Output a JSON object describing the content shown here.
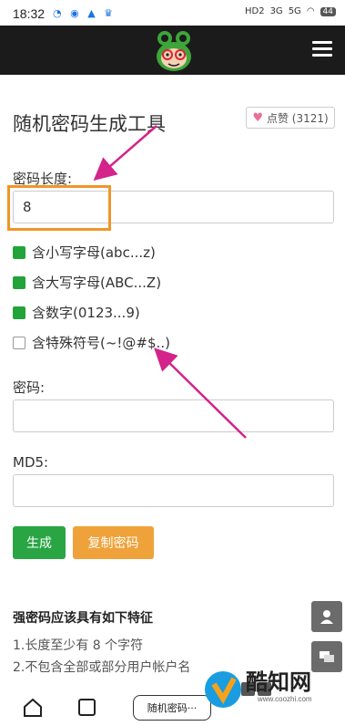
{
  "status_bar": {
    "time": "18:32",
    "battery": "44",
    "signal_texts": [
      "HD2",
      "3G",
      "5G"
    ]
  },
  "header": {
    "menu_icon": "hamburger-icon",
    "logo_icon": "frog-logo-icon"
  },
  "page": {
    "title": "随机密码生成工具",
    "like_button": {
      "label": "点赞 (3121)",
      "icon": "heart-icon",
      "icon_color": "#e86f95"
    }
  },
  "form": {
    "length_label": "密码长度:",
    "length_value": "8",
    "options": [
      {
        "label": "含小写字母(abc...z)",
        "checked": true
      },
      {
        "label": "含大写字母(ABC...Z)",
        "checked": true
      },
      {
        "label": "含数字(0123...9)",
        "checked": true
      },
      {
        "label": "含特殊符号(~!@#$..)",
        "checked": false
      }
    ],
    "password_label": "密码:",
    "password_value": "",
    "md5_label": "MD5:",
    "md5_value": "",
    "generate_button": "生成",
    "copy_button": "复制密码"
  },
  "features": {
    "title": "强密码应该具有如下特征",
    "items": [
      "1.长度至少有 8 个字符",
      "2.不包含全部或部分用户帐户名"
    ]
  },
  "bottom_bar": {
    "tab_label": "随机密码···"
  },
  "watermark": {
    "text": "酷知网",
    "url": "www.coozhi.com"
  },
  "colors": {
    "green": "#2aa544",
    "orange": "#f0a23a",
    "highlight": "#f0952a",
    "arrow": "#d4238a",
    "navbar": "#1b1b1b"
  }
}
